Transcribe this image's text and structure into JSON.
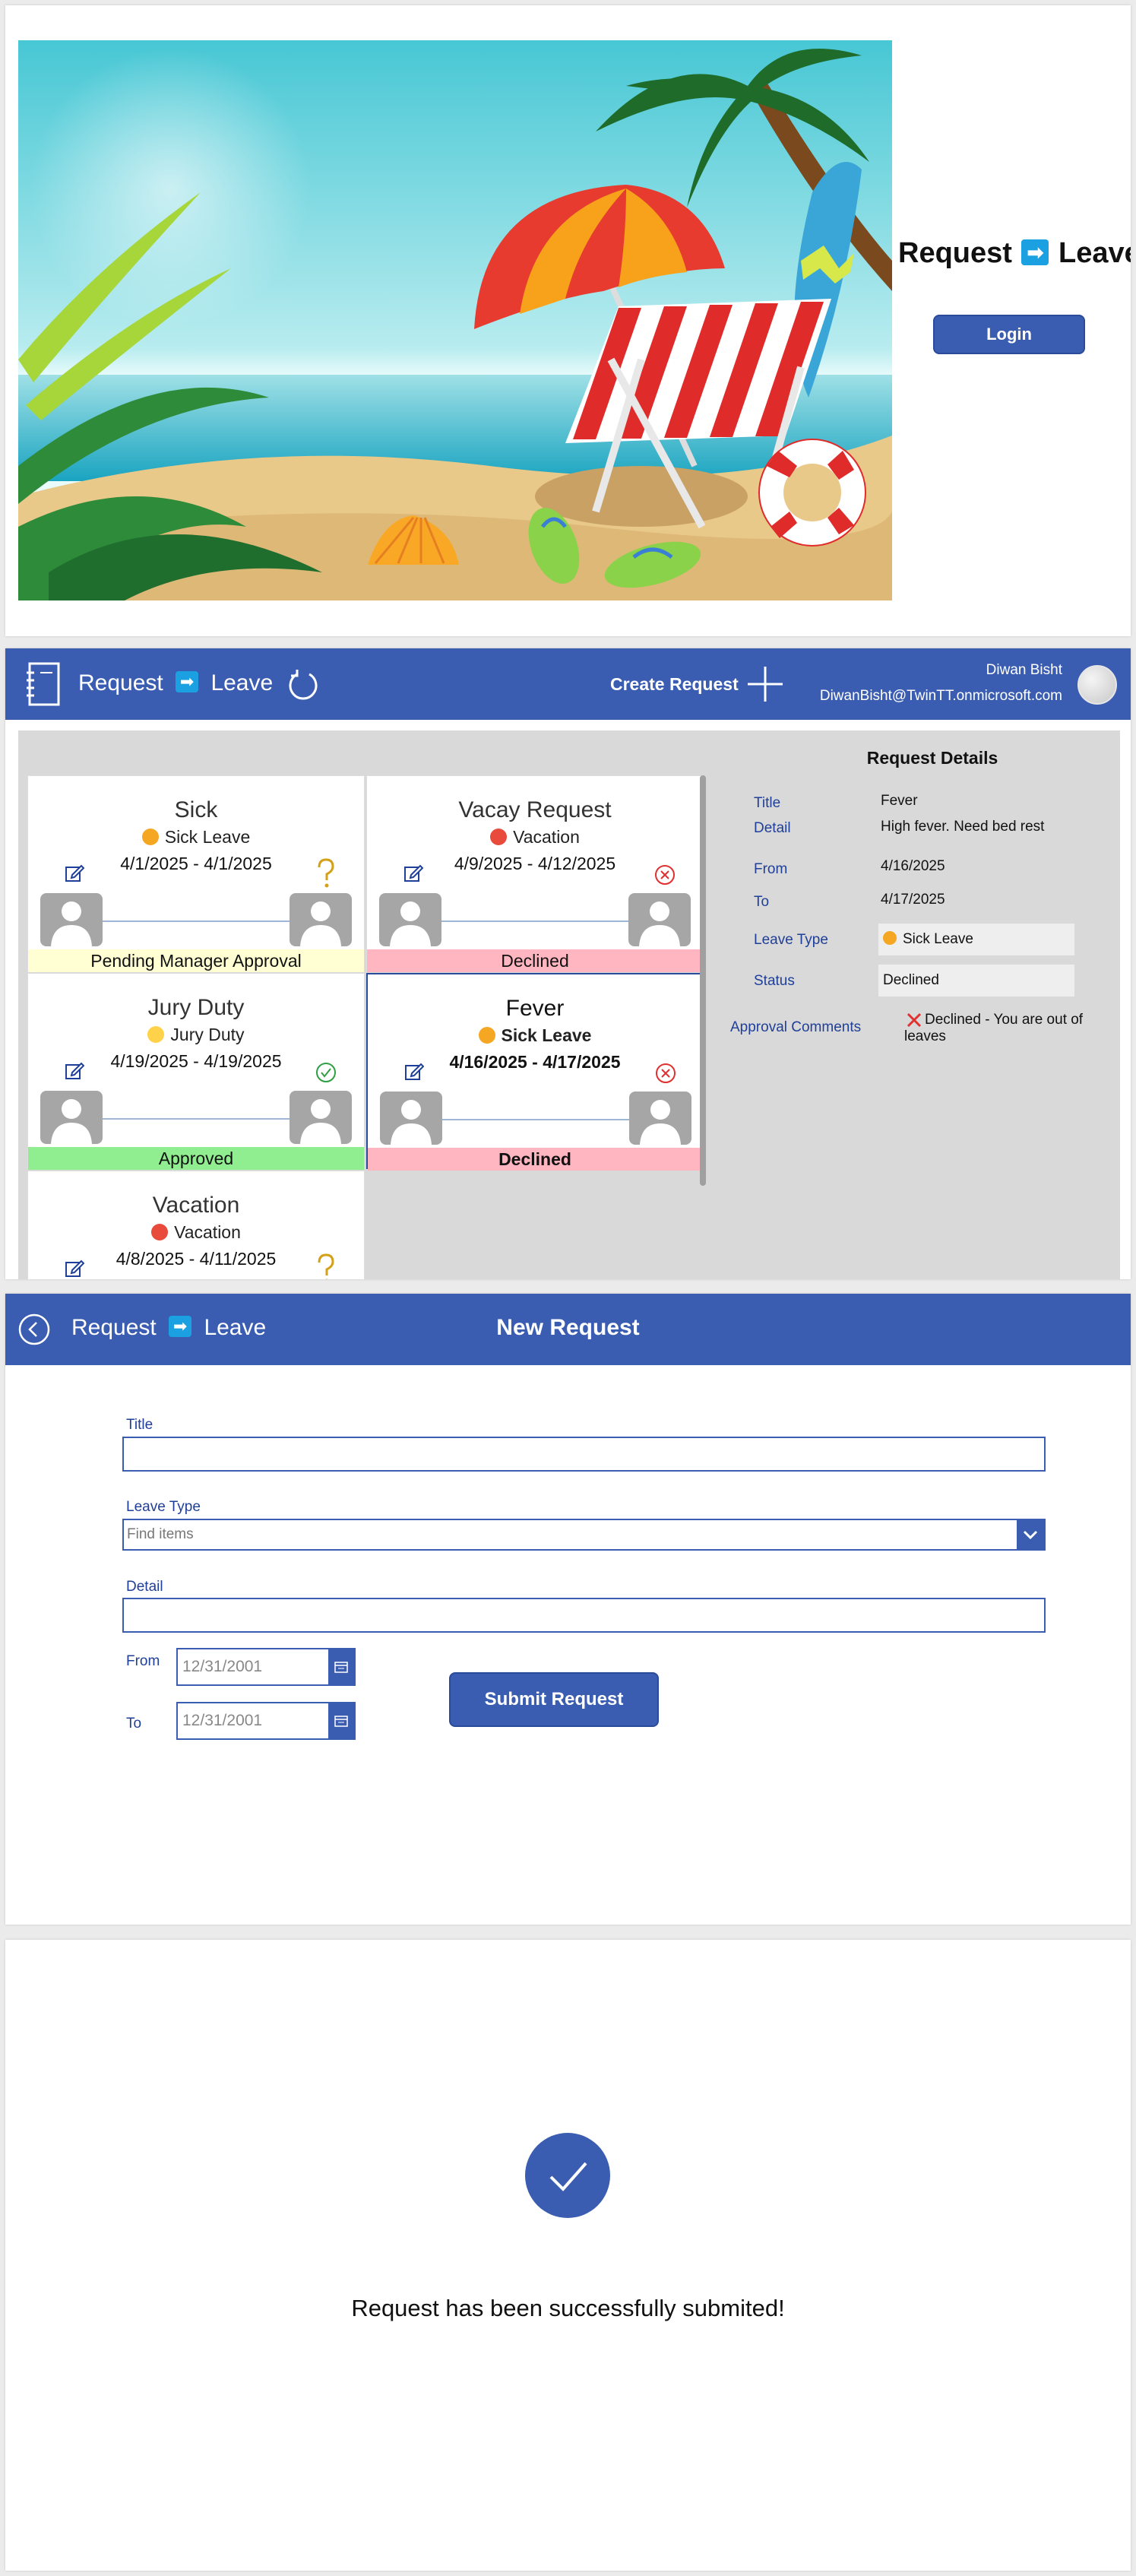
{
  "brand": {
    "prefix": "Request",
    "arrow": "➡",
    "suffix": "Leave"
  },
  "login": {
    "button_label": "Login"
  },
  "list_screen": {
    "create_label": "Create Request",
    "user_name": "Diwan Bisht",
    "user_email": "DiwanBisht@TwinTT.onmicrosoft.com",
    "cards": [
      {
        "title": "Sick",
        "type": "Sick Leave",
        "type_icon_color": "#f5a623",
        "dates": "4/1/2025 - 4/1/2025",
        "status": "Pending Manager Approval",
        "status_icon": "question-icon"
      },
      {
        "title": "Vacay Request",
        "type": "Vacation",
        "type_icon_color": "#e84a3c",
        "dates": "4/9/2025 - 4/12/2025",
        "status": "Declined",
        "status_icon": "x-circle-icon"
      },
      {
        "title": "Jury Duty",
        "type": "Jury Duty",
        "type_icon_color": "#ffd24a",
        "dates": "4/19/2025 - 4/19/2025",
        "status": "Approved",
        "status_icon": "check-circle-icon"
      },
      {
        "title": "Fever",
        "type": "Sick Leave",
        "type_icon_color": "#f5a623",
        "dates": "4/16/2025 - 4/17/2025",
        "status": "Declined",
        "status_icon": "x-circle-icon"
      },
      {
        "title": "Vacation",
        "type": "Vacation",
        "type_icon_color": "#e84a3c",
        "dates": "4/8/2025 - 4/11/2025",
        "status": "",
        "status_icon": "question-icon"
      }
    ],
    "details": {
      "heading": "Request Details",
      "title_label": "Title",
      "title_value": "Fever",
      "detail_label": "Detail",
      "detail_value": "High fever. Need bed rest",
      "from_label": "From",
      "from_value": "4/16/2025",
      "to_label": "To",
      "to_value": "4/17/2025",
      "leave_type_label": "Leave Type",
      "leave_type_value": "Sick Leave",
      "status_label": "Status",
      "status_value": "Declined",
      "comments_label": "Approval Comments",
      "comments_value_1": "Declined - You are out of",
      "comments_value_2": "leaves"
    }
  },
  "new_request": {
    "page_title": "New Request",
    "title_label": "Title",
    "leave_type_label": "Leave Type",
    "leave_type_placeholder": "Find items",
    "detail_label": "Detail",
    "from_label": "From",
    "from_value": "12/31/2001",
    "to_label": "To",
    "to_value": "12/31/2001",
    "submit_label": "Submit Request"
  },
  "success": {
    "message": "Request has been successfully submited!"
  },
  "colors": {
    "primary": "#3a5db2",
    "pending": "#ffffd3",
    "declined": "#ffb6c1",
    "approved": "#90ee90",
    "panel": "#d9d9d9"
  }
}
